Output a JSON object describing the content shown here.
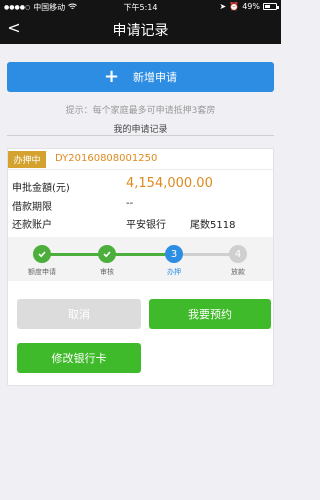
{
  "status_bar": {
    "carrier": "中国移动",
    "time": "下午5:14",
    "battery": "49%"
  },
  "nav": {
    "back": "<",
    "title": "申请记录"
  },
  "add_button": {
    "icon": "+",
    "label": "新增申请"
  },
  "hint": "提示：每个家庭最多可申请抵押3套房",
  "section_title": "我的申请记录",
  "record": {
    "status_tag": "办押中",
    "order_no": "DY20160808001250",
    "amount_label": "申批金額(元)",
    "amount_value": "4,154,000.00",
    "term_label": "借款期限",
    "term_value": "--",
    "account_label": "还款账户",
    "bank_name": "平安银行",
    "tail_number": "尾数5118",
    "steps": [
      {
        "label": "额度申请",
        "state": "done",
        "mark": ""
      },
      {
        "label": "审核",
        "state": "done",
        "mark": ""
      },
      {
        "label": "办押",
        "state": "current",
        "mark": "3"
      },
      {
        "label": "放款",
        "state": "todo",
        "mark": "4"
      }
    ],
    "cancel_label": "取消",
    "book_label": "我要预约",
    "modify_card_label": "修改银行卡"
  },
  "colors": {
    "accent_blue": "#2d8de3",
    "green": "#3fba2a",
    "orange": "#e08a1e",
    "tag_gold": "#d4a22f"
  }
}
